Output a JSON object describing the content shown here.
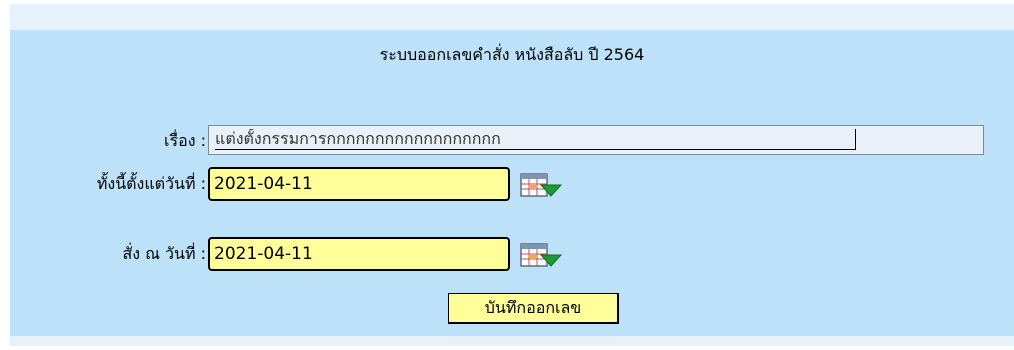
{
  "form": {
    "title": "ระบบออกเลขคำสั่ง หนังสือลับ ปี 2564",
    "subject_label": "เรื่อง :",
    "subject_value": "แต่งตั้งกรรมการกกกกกกกกกกกกกกกกกก",
    "effective_date_label": "ทั้งนี้ตั้งแต่วันที่ :",
    "effective_date_value": "2021-04-11",
    "order_date_label": "สั่ง ณ วันที่ :",
    "order_date_value": "2021-04-11",
    "submit_label": "บันทึกออกเลข"
  },
  "icons": {
    "calendar": "calendar-dropdown-icon"
  },
  "colors": {
    "panel_background": "#bde1f8",
    "outer_background": "#e6f2fb",
    "input_highlight": "#ffff99",
    "calendar_accent": "#1f9a3a"
  }
}
